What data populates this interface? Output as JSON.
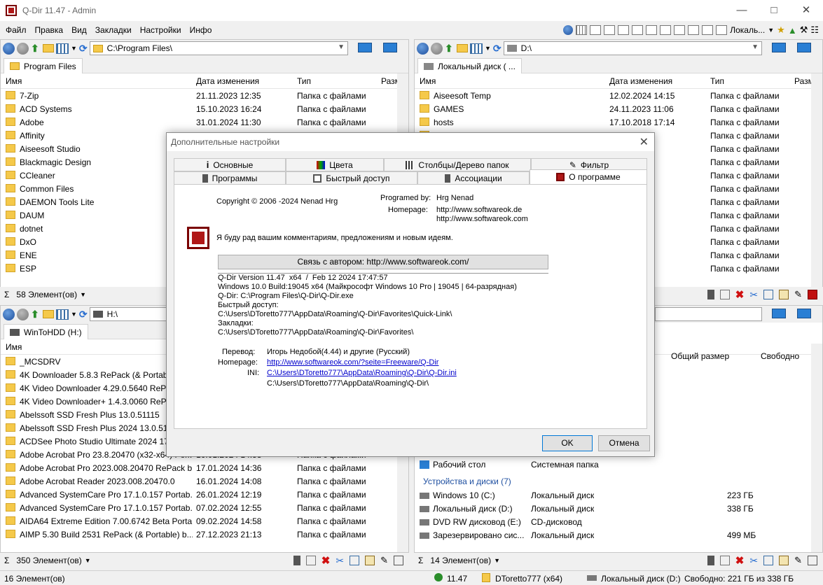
{
  "window": {
    "title": "Q-Dir 11.47 - Admin"
  },
  "menu": [
    "Файл",
    "Правка",
    "Вид",
    "Закладки",
    "Настройки",
    "Инфо"
  ],
  "toolbar": {
    "locale_label": "Локаль..."
  },
  "pane_tl": {
    "path": "C:\\Program Files\\",
    "tab": "Program Files",
    "cols": [
      "Имя",
      "Дата изменения",
      "Тип",
      "Разм"
    ],
    "rows": [
      [
        "7-Zip",
        "21.11.2023 12:35",
        "Папка с файлами"
      ],
      [
        "ACD Systems",
        "15.10.2023 16:24",
        "Папка с файлами"
      ],
      [
        "Adobe",
        "31.01.2024 11:30",
        "Папка с файлами"
      ],
      [
        "Affinity",
        "",
        ""
      ],
      [
        "Aiseesoft Studio",
        "",
        ""
      ],
      [
        "Blackmagic Design",
        "",
        ""
      ],
      [
        "CCleaner",
        "",
        ""
      ],
      [
        "Common Files",
        "",
        ""
      ],
      [
        "DAEMON Tools Lite",
        "",
        ""
      ],
      [
        "DAUM",
        "",
        ""
      ],
      [
        "dotnet",
        "",
        ""
      ],
      [
        "DxO",
        "",
        ""
      ],
      [
        "ENE",
        "",
        ""
      ],
      [
        "ESP",
        "",
        ""
      ]
    ],
    "status": "58 Элемент(ов)"
  },
  "pane_tr": {
    "path": "D:\\",
    "tab": "Локальный диск ( ...",
    "cols": [
      "Имя",
      "Дата изменения",
      "Тип",
      "Разм"
    ],
    "rows": [
      [
        "Aiseesoft Temp",
        "12.02.2024 14:15",
        "Папка с файлами"
      ],
      [
        "GAMES",
        "24.11.2023 11:06",
        "Папка с файлами"
      ],
      [
        "hosts",
        "17.10.2018 17:14",
        "Папка с файлами"
      ],
      [
        "",
        ":17",
        "Папка с файлами"
      ],
      [
        "",
        ":53",
        "Папка с файлами"
      ],
      [
        "",
        ":38",
        "Папка с файлами"
      ],
      [
        "",
        ":29",
        "Папка с файлами"
      ],
      [
        "",
        ":24",
        "Папка с файлами"
      ],
      [
        "",
        ":30",
        "Папка с файлами"
      ],
      [
        "",
        ":08",
        "Папка с файлами"
      ],
      [
        "",
        ":18",
        "Папка с файлами"
      ],
      [
        "",
        ":48",
        "Папка с файлами"
      ],
      [
        "",
        ":45",
        "Папка с файлами"
      ],
      [
        "",
        ":58",
        "Папка с файлами"
      ]
    ]
  },
  "pane_bl": {
    "path": "H:\\",
    "tab": "WinToHDD (H:)",
    "cols": [
      "Имя"
    ],
    "rows": [
      [
        "_MCSDRV",
        "",
        ""
      ],
      [
        "4K Downloader 5.8.3 RePack (& Portable",
        "",
        ""
      ],
      [
        "4K Video Downloader 4.29.0.5640 RePack",
        "",
        ""
      ],
      [
        "4K Video Downloader+ 1.4.3.0060 RePack",
        "",
        ""
      ],
      [
        "Abelssoft SSD Fresh Plus 13.0.51115",
        "",
        ""
      ],
      [
        "Abelssoft SSD Fresh Plus 2024 13.0.51115",
        "",
        ""
      ],
      [
        "ACDSee Photo Studio Ultimate 2024 17.0",
        "",
        ""
      ],
      [
        "Adobe Acrobat Pro 23.8.20470 (x32-x64) Por...",
        "16.01.2024 14:58",
        "Папка с файлами"
      ],
      [
        "Adobe Acrobat Pro 2023.008.20470 RePack b...",
        "17.01.2024 14:36",
        "Папка с файлами"
      ],
      [
        "Adobe Acrobat Reader 2023.008.20470.0",
        "16.01.2024 14:08",
        "Папка с файлами"
      ],
      [
        "Advanced SystemCare Pro 17.1.0.157 Portab...",
        "26.01.2024 12:19",
        "Папка с файлами"
      ],
      [
        "Advanced SystemCare Pro 17.1.0.157 Portab...",
        "07.02.2024 12:55",
        "Папка с файлами"
      ],
      [
        "AIDA64 Extreme Edition 7.00.6742 Beta Porta...",
        "09.02.2024 14:58",
        "Папка с файлами"
      ],
      [
        "AIMP 5.30 Build 2531 RePack (& Portable) b...",
        "27.12.2023 21:13",
        "Папка с файлами"
      ]
    ],
    "status": "350 Элемент(ов)"
  },
  "pane_br": {
    "cols": [
      "Общий размер",
      "Свободно"
    ],
    "desktop": [
      "Рабочий стол",
      "Системная папка"
    ],
    "group": "Устройства и диски (7)",
    "drives": [
      [
        "Windows 10 (C:)",
        "Локальный диск",
        "223 ГБ"
      ],
      [
        "Локальный диск (D:)",
        "Локальный диск",
        "338 ГБ"
      ],
      [
        "DVD RW дисковод (E:)",
        "CD-дисковод",
        ""
      ],
      [
        "Зарезервировано сис...",
        "Локальный диск",
        "499 МБ"
      ]
    ],
    "status": "14 Элемент(ов)"
  },
  "dialog": {
    "title": "Дополнительные настройки",
    "tabs_row1": [
      "Основные",
      "Цвета",
      "Столбцы/Дерево папок",
      "Фильтр"
    ],
    "tabs_row2": [
      "Программы",
      "Быстрый доступ",
      "Ассоциации",
      "О программе"
    ],
    "copyright": "Copyright © 2006 -2024 Nenad Hrg",
    "programmed_by_label": "Programed by:",
    "programmed_by": "Hrg Nenad",
    "homepage_label": "Homepage:",
    "homepage1": "http://www.softwareok.de",
    "homepage2": "http://www.softwareok.com",
    "message": "Я буду рад вашим комментариям, предложениям и новым идеям.",
    "contact_button": "Связь с автором: http://www.softwareok.com/",
    "info": "Q-Dir Version 11.47  x64  /  Feb 12 2024 17:47:57\nWindows 10.0 Build:19045 x64 (Майкрософт Windows 10 Pro | 19045 | 64-разрядная)\nQ-Dir: C:\\Program Files\\Q-Dir\\Q-Dir.exe\nБыстрый доступ:\nC:\\Users\\DToretto777\\AppData\\Roaming\\Q-Dir\\Favorites\\Quick-Link\\\nЗакладки:\nC:\\Users\\DToretto777\\AppData\\Roaming\\Q-Dir\\Favorites\\",
    "translation_label": "Перевод:",
    "translation": "Игорь Недобой(4.44) и другие  (Русский)",
    "homepage3_label": "Homepage:",
    "homepage3": "http://www.softwareok.com/?seite=Freeware/Q-Dir",
    "ini_label": "INI:",
    "ini": "C:\\Users\\DToretto777\\AppData\\Roaming\\Q-Dir\\Q-Dir.ini",
    "ini_dir": "C:\\Users\\DToretto777\\AppData\\Roaming\\Q-Dir\\",
    "ok": "OK",
    "cancel": "Отмена"
  },
  "bottom": {
    "left": "16 Элемент(ов)",
    "version": "11.47",
    "user": "DToretto777 (x64)",
    "disk": "Локальный диск (D:)",
    "free": "Свободно: 221 ГБ из 338 ГБ"
  }
}
